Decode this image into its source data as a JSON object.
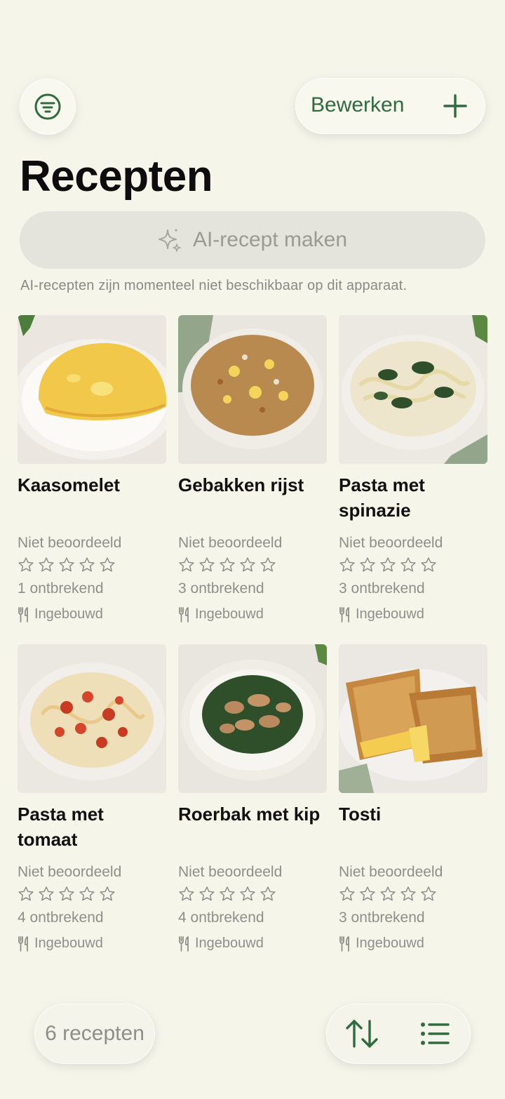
{
  "header": {
    "filter_icon": "filter-icon",
    "edit_label": "Bewerken",
    "add_icon": "plus-icon",
    "title": "Recepten"
  },
  "ai": {
    "icon": "sparkles-icon",
    "button_label": "AI-recept maken",
    "note": "AI-recepten zijn momenteel niet beschikbaar op dit apparaat."
  },
  "recipes": [
    {
      "name": "Kaasomelet",
      "rating_text": "Niet beoordeeld",
      "stars": 0,
      "missing": "1 ontbrekend",
      "source": "Ingebouwd",
      "image": "omelette"
    },
    {
      "name": "Gebakken rijst",
      "rating_text": "Niet beoordeeld",
      "stars": 0,
      "missing": "3 ontbrekend",
      "source": "Ingebouwd",
      "image": "fried-rice"
    },
    {
      "name": "Pasta met spinazie",
      "rating_text": "Niet beoordeeld",
      "stars": 0,
      "missing": "3 ontbrekend",
      "source": "Ingebouwd",
      "image": "spinach-pasta"
    },
    {
      "name": "Pasta met tomaat",
      "rating_text": "Niet beoordeeld",
      "stars": 0,
      "missing": "4 ontbrekend",
      "source": "Ingebouwd",
      "image": "tomato-pasta"
    },
    {
      "name": "Roerbak met kip",
      "rating_text": "Niet beoordeeld",
      "stars": 0,
      "missing": "4 ontbrekend",
      "source": "Ingebouwd",
      "image": "chicken-stirfry"
    },
    {
      "name": "Tosti",
      "rating_text": "Niet beoordeeld",
      "stars": 0,
      "missing": "3 ontbrekend",
      "source": "Ingebouwd",
      "image": "tosti"
    }
  ],
  "footer": {
    "count_label": "6 recepten",
    "sort_icon": "sort-arrows-icon",
    "list_icon": "list-view-icon"
  },
  "colors": {
    "background": "#f5f5ea",
    "accent": "#2f6b3f",
    "muted": "#8f8f8a"
  }
}
